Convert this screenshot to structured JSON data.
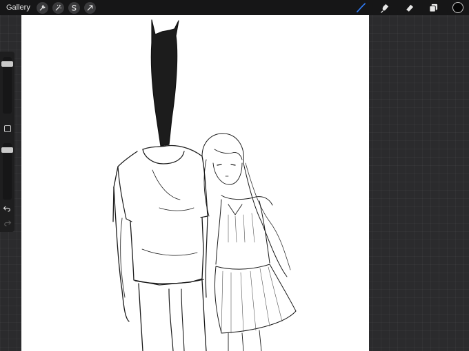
{
  "topbar": {
    "gallery_label": "Gallery",
    "left_tools": [
      "wrench-icon",
      "magic-wand-icon",
      "selection-icon",
      "transform-icon"
    ],
    "right_tools": [
      "brush-icon",
      "smudge-icon",
      "eraser-icon",
      "layers-icon"
    ],
    "active_tool": "brush-icon",
    "accent_color": "#2f7bf5",
    "current_color": "#050505"
  },
  "sidebar": {
    "brush_size": 0.92,
    "brush_opacity": 0.92,
    "icons": [
      "modifier-square-icon",
      "undo-icon",
      "redo-icon"
    ]
  },
  "canvas": {
    "background_color": "#ffffff",
    "content": "sketch-drawing"
  }
}
